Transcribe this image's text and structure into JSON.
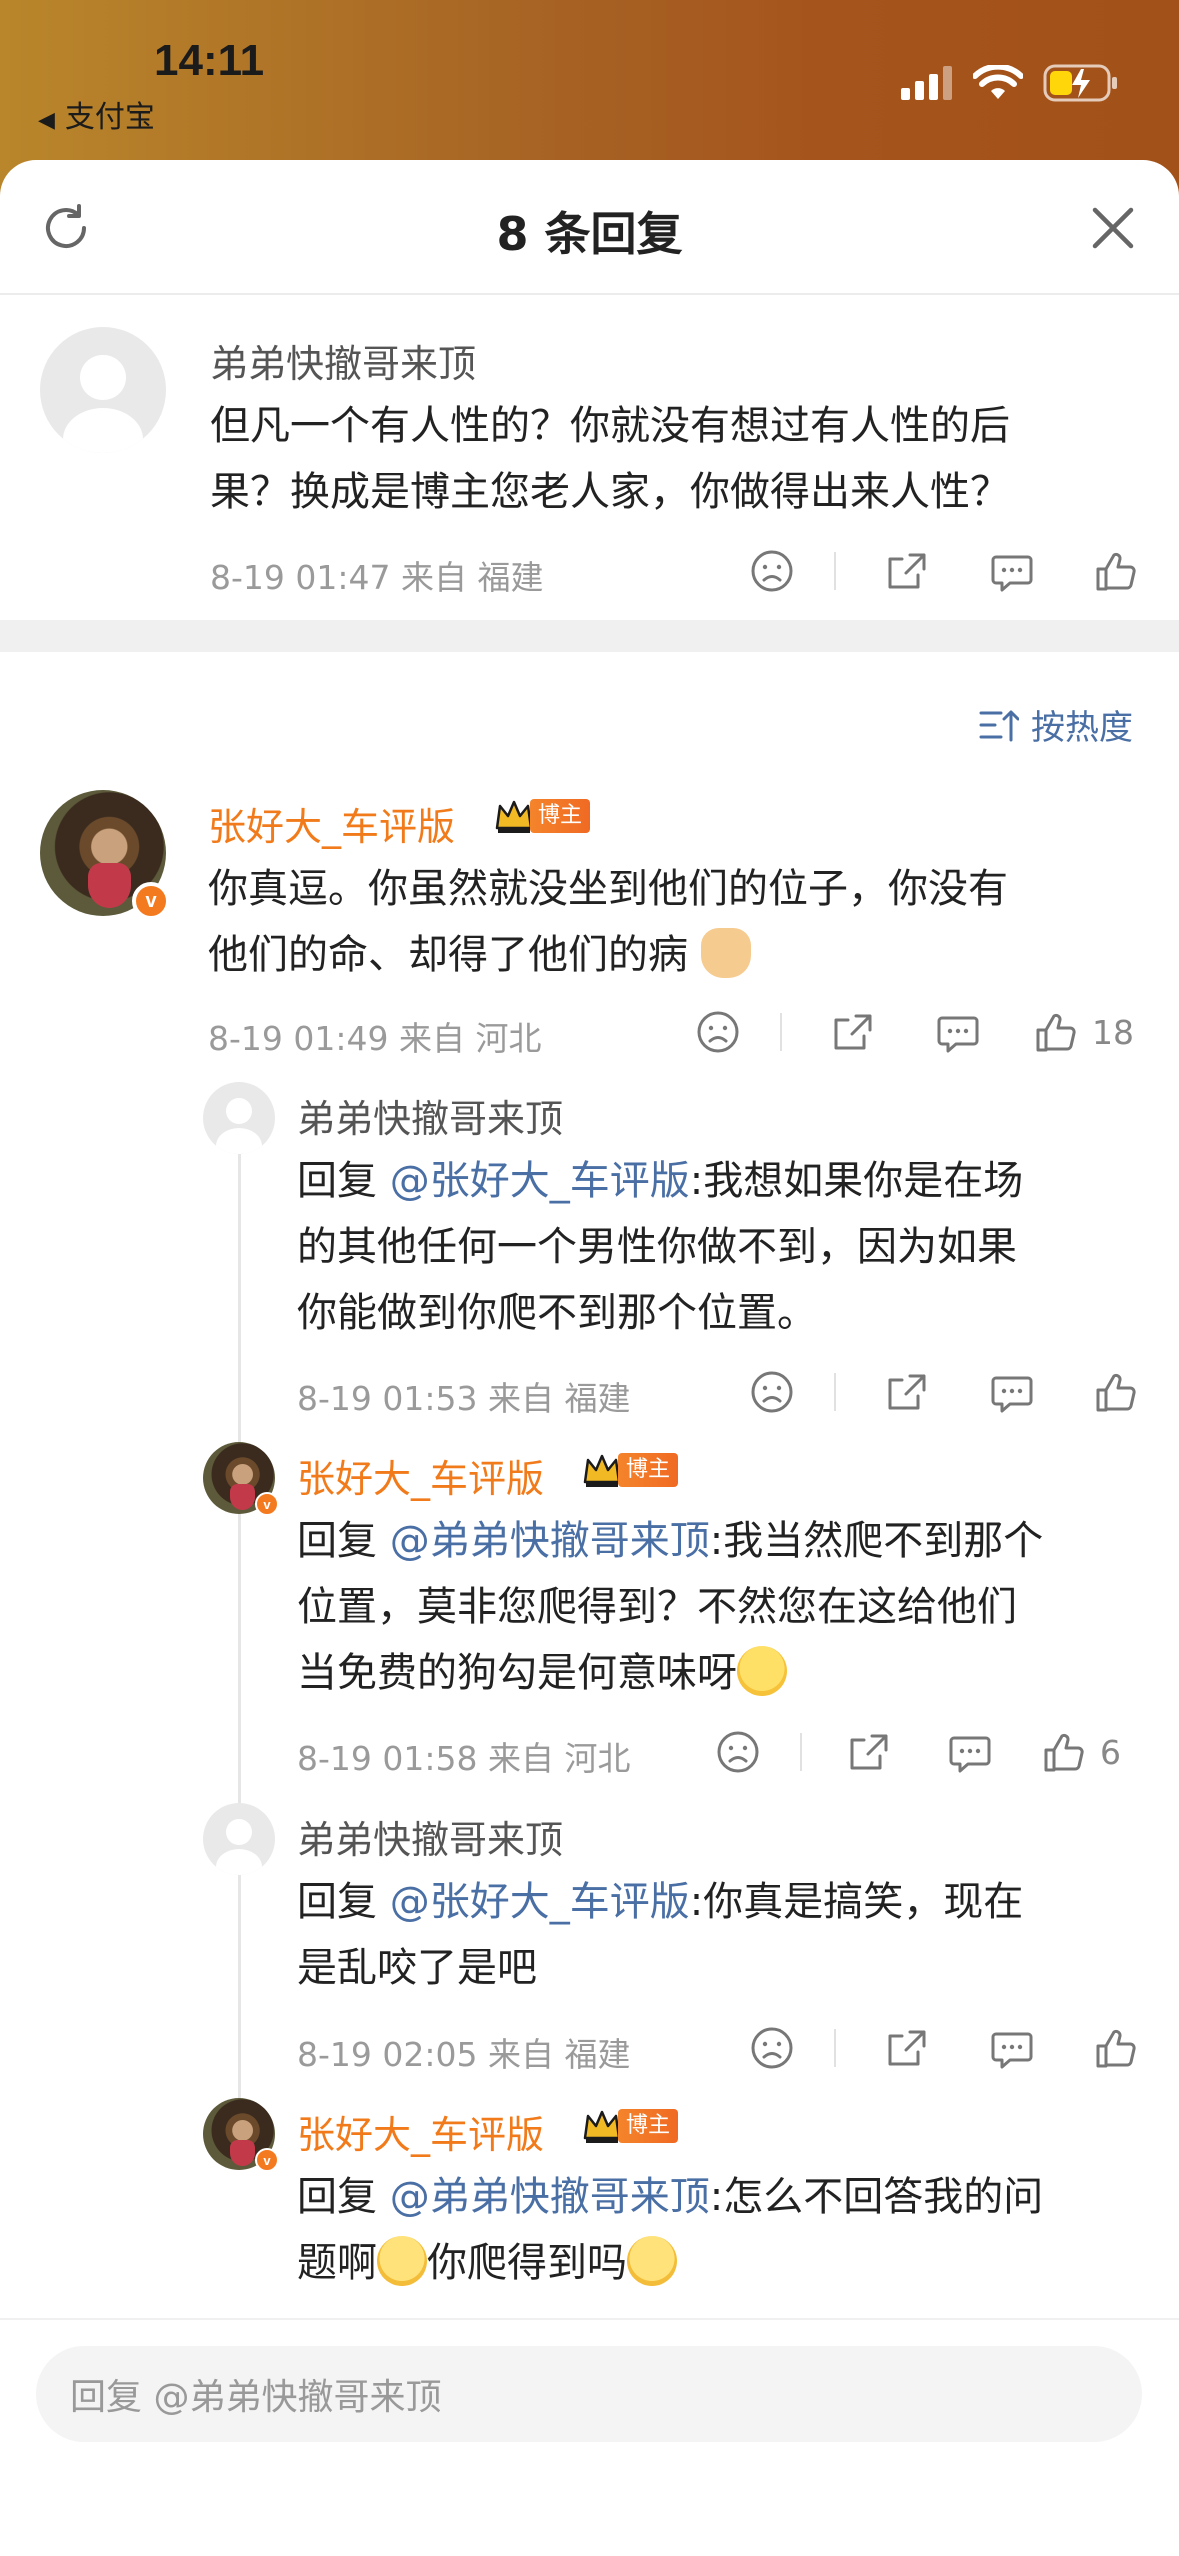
{
  "status_bar": {
    "time": "14:11",
    "back_app": "支付宝"
  },
  "header": {
    "title": "8 条回复"
  },
  "root_comment": {
    "username": "弟弟快撤哥来顶",
    "text_line1": "但凡一个有人性的？你就没有想过有人性的后",
    "text_line2": "果？换成是博主您老人家，你做得出来人性？",
    "meta": "8-19 01:47  来自 福建"
  },
  "sort": {
    "label": "按热度"
  },
  "main_comment": {
    "username": "张好大_车评版",
    "badge": "博主",
    "text_line1": "你真逗。你虽然就没坐到他们的位子，你没有",
    "text_line2": "他们的命、却得了他们的病",
    "meta": "8-19 01:49  来自 河北",
    "like_count": "18"
  },
  "replies": [
    {
      "username": "弟弟快撤哥来顶",
      "prefix": "回复 ",
      "mention": "@张好大_车评版",
      "line1": ":我想如果你是在场",
      "line2": "的其他任何一个男性你做不到，因为如果",
      "line3": "你能做到你爬不到那个位置。",
      "meta": "8-19 01:53  来自 福建"
    },
    {
      "username": "张好大_车评版",
      "badge": "博主",
      "prefix": "回复 ",
      "mention": "@弟弟快撤哥来顶",
      "line1": ":我当然爬不到那个",
      "line2": "位置，莫非您爬得到？不然您在这给他们",
      "line3": "当免费的狗勾是何意味呀",
      "meta": "8-19 01:58  来自 河北",
      "like_count": "6"
    },
    {
      "username": "弟弟快撤哥来顶",
      "prefix": "回复 ",
      "mention": "@张好大_车评版",
      "line1": ":你真是搞笑，现在",
      "line2": "是乱咬了是吧",
      "meta": "8-19 02:05  来自 福建"
    },
    {
      "username": "张好大_车评版",
      "badge": "博主",
      "prefix": "回复 ",
      "mention": "@弟弟快撤哥来顶",
      "line1": ":怎么不回答我的问",
      "line2a": "题啊",
      "line2b": "你爬得到吗"
    }
  ],
  "reply_bar": {
    "placeholder": "回复 @弟弟快撤哥来顶"
  },
  "colors": {
    "accent_orange": "#f17b1b",
    "mention_blue": "#4a6fa5",
    "status_gradient_left": "#b9862b",
    "status_gradient_right": "#a25118"
  }
}
